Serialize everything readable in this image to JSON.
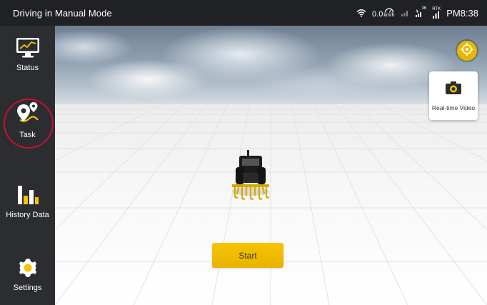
{
  "topbar": {
    "mode": "Driving in Manual Mode",
    "speed_value": "0.0",
    "speed_unit": "km/h",
    "satellite_count": "36",
    "rtk_label": "RTK",
    "time": "PM8:38",
    "icons": [
      "wifi-icon",
      "speedometer-icon",
      "signal-bars-icon",
      "satellite-signal-icon",
      "rtk-signal-icon"
    ]
  },
  "sidebar": {
    "items": [
      {
        "label": "Status",
        "icon": "monitor-chart-icon"
      },
      {
        "label": "Task",
        "icon": "route-pins-icon",
        "selected": true
      },
      {
        "label": "History Data",
        "icon": "bar-chart-icon"
      },
      {
        "label": "Settings",
        "icon": "gear-icon"
      }
    ]
  },
  "scene": {
    "video_label": "Real-time Video",
    "start_label": "Start",
    "recenter_icon": "crosshair-icon",
    "vehicle_icon": "tractor-icon"
  },
  "colors": {
    "accent": "#f5c400",
    "sidebar": "#2b2d31",
    "topbar": "#202124",
    "selected_ring": "#c8102e"
  }
}
